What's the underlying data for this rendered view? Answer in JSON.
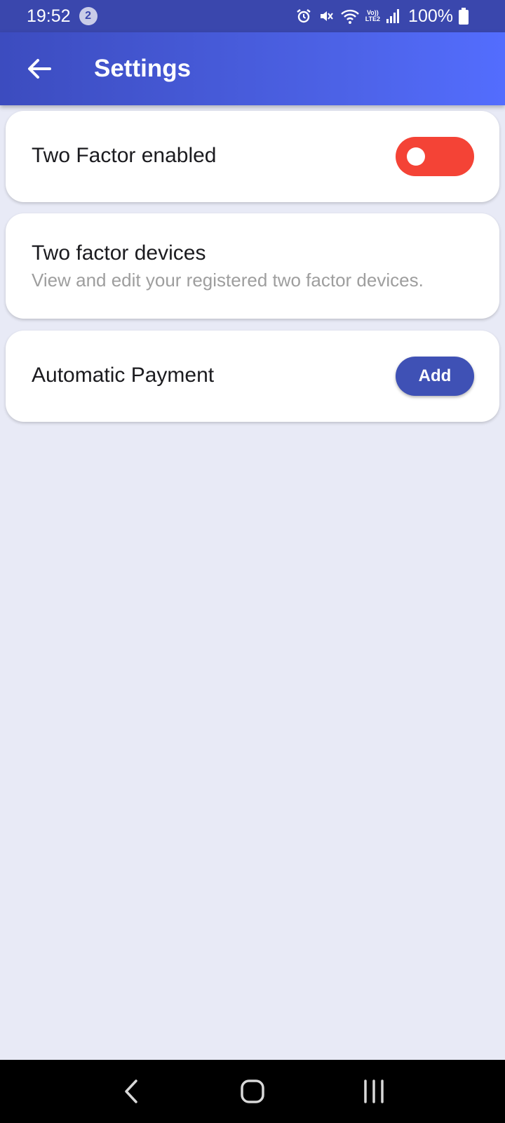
{
  "status_bar": {
    "time": "19:52",
    "notification_count": "2",
    "battery": "100%",
    "network_label_top": "Vo))",
    "network_label_bottom": "LTE2",
    "icons": [
      "alarm-icon",
      "mute-icon",
      "wifi-icon",
      "volte-icon",
      "signal-icon",
      "battery-icon"
    ]
  },
  "app_bar": {
    "title": "Settings",
    "back_icon": "arrow-left-icon",
    "gradient_start": "#3c4cbf",
    "gradient_end": "#536dfe"
  },
  "settings": [
    {
      "title": "Two Factor enabled",
      "control": "toggle",
      "toggle_on": false,
      "toggle_color": "#f44336"
    },
    {
      "title": "Two factor devices",
      "subtitle": "View and edit your registered two factor devices."
    },
    {
      "title": "Automatic Payment",
      "control": "button",
      "button_label": "Add",
      "button_color": "#3f51b5"
    }
  ],
  "nav_bar": {
    "icons": [
      "back-nav-icon",
      "home-nav-icon",
      "recents-nav-icon"
    ]
  },
  "colors": {
    "background": "#e8eaf6",
    "status_bar": "#3a47ad"
  }
}
